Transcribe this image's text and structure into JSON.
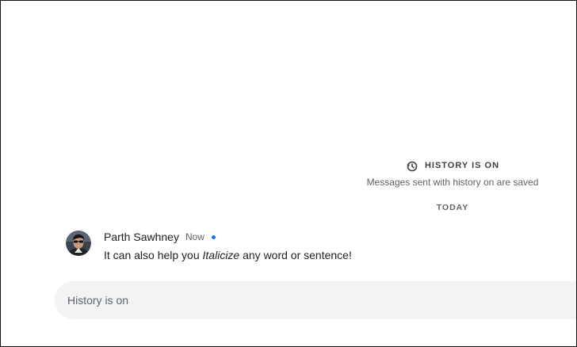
{
  "history_notice": {
    "icon": "history-icon",
    "title": "HISTORY IS ON",
    "subtitle": "Messages sent with history on are saved"
  },
  "date_divider": "TODAY",
  "message": {
    "sender": "Parth Sawhney",
    "time": "Now",
    "text_before": "It can also help you ",
    "text_italic": "Italicize",
    "text_after": " any word or sentence!",
    "unread_dot_color": "#1a73e8"
  },
  "composer": {
    "placeholder": "History is on"
  }
}
